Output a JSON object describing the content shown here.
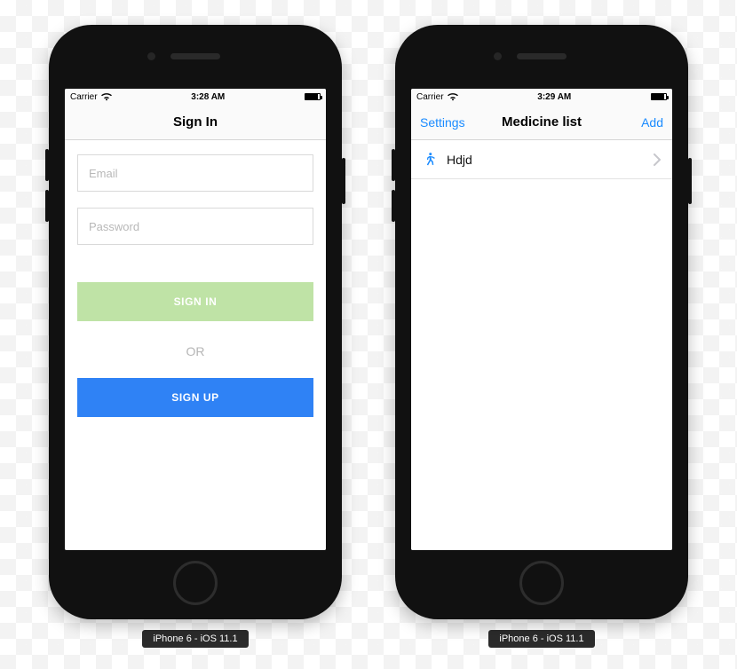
{
  "devices": {
    "left": {
      "label": "iPhone 6 - iOS 11.1"
    },
    "right": {
      "label": "iPhone 6 - iOS 11.1"
    }
  },
  "statusbar": {
    "left": {
      "carrier": "Carrier",
      "time": "3:28 AM"
    },
    "right": {
      "carrier": "Carrier",
      "time": "3:29 AM"
    }
  },
  "signin": {
    "title": "Sign In",
    "email_placeholder": "Email",
    "password_placeholder": "Password",
    "signin_label": "SIGN IN",
    "or_label": "OR",
    "signup_label": "SIGN UP"
  },
  "medlist": {
    "nav_left": "Settings",
    "title": "Medicine list",
    "nav_right": "Add",
    "items": [
      {
        "name": "Hdjd"
      }
    ]
  },
  "colors": {
    "ios_blue": "#1a8bff",
    "signin_btn": "#bfe3a6",
    "signup_btn": "#2f82f5"
  }
}
